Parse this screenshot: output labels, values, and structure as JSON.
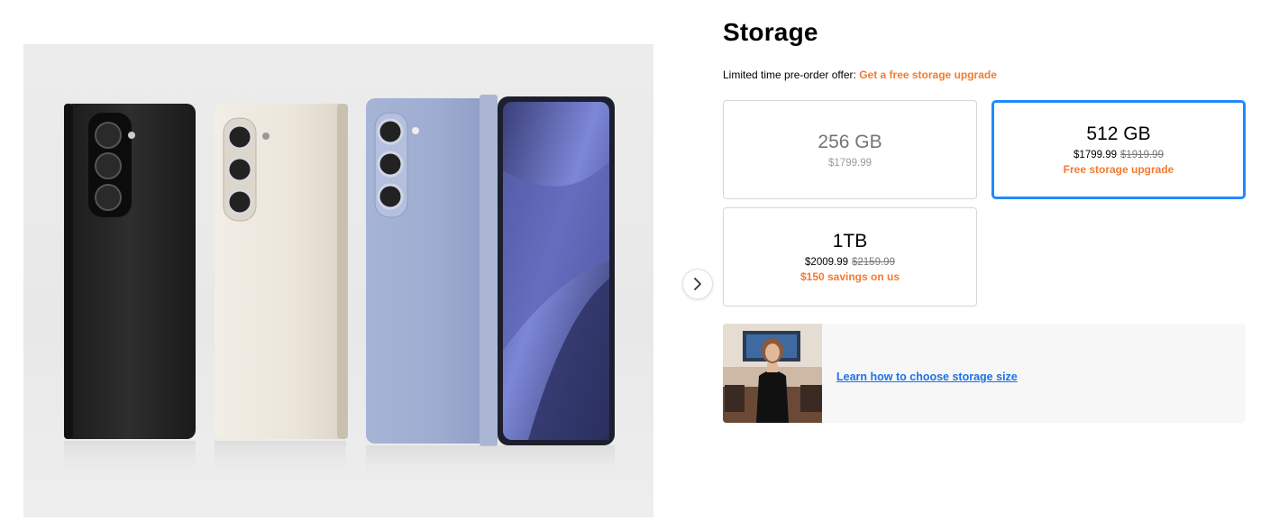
{
  "section": {
    "title": "Storage",
    "offer_prefix": "Limited time pre-order offer:",
    "offer_highlight": "Get a free storage upgrade"
  },
  "options": [
    {
      "size": "256 GB",
      "price": "$1799.99",
      "original_price": "",
      "promo": "",
      "state": "unavailable"
    },
    {
      "size": "512 GB",
      "price": "$1799.99",
      "original_price": "$1919.99",
      "promo": "Free storage upgrade",
      "state": "selected"
    },
    {
      "size": "1TB",
      "price": "$2009.99",
      "original_price": "$2159.99",
      "promo": "$150 savings on us",
      "state": "available"
    }
  ],
  "learn": {
    "link_text": "Learn how to choose storage size"
  },
  "icons": {
    "next": "chevron-right-icon"
  },
  "colors": {
    "accent_orange": "#f47a30",
    "selected_border": "#2189ff",
    "link": "#1a73e8"
  }
}
